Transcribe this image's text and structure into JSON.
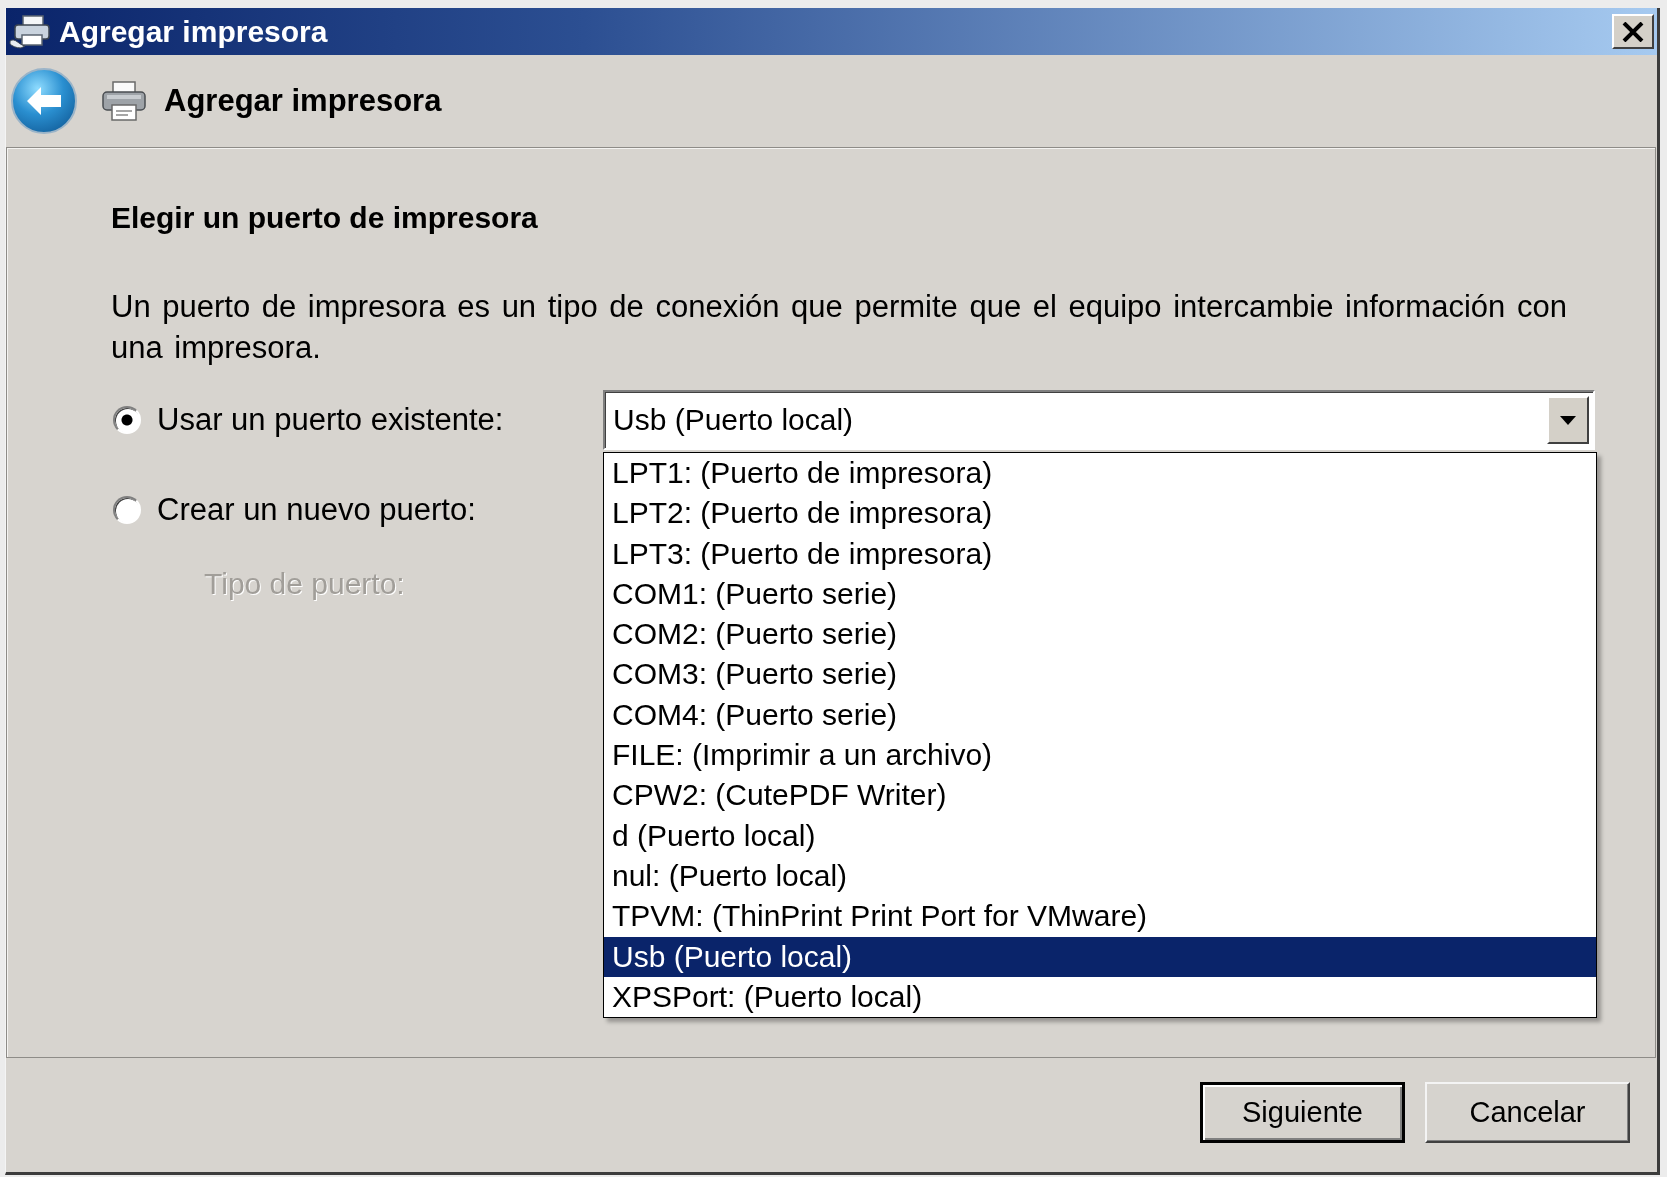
{
  "window": {
    "title": "Agregar impresora"
  },
  "header": {
    "title": "Agregar impresora"
  },
  "page": {
    "heading": "Elegir un puerto de impresora",
    "description": "Un puerto de impresora es un tipo de conexión que permite que el equipo intercambie información con una impresora.",
    "port_options": [
      {
        "label": "Usar un puerto existente:",
        "selected": true
      },
      {
        "label": "Crear un nuevo puerto:",
        "selected": false
      }
    ],
    "existing_port": {
      "value": "Usb (Puerto local)",
      "expanded": true,
      "options": [
        {
          "label": "LPT1: (Puerto de impresora)",
          "selected": false
        },
        {
          "label": "LPT2: (Puerto de impresora)",
          "selected": false
        },
        {
          "label": "LPT3: (Puerto de impresora)",
          "selected": false
        },
        {
          "label": "COM1: (Puerto serie)",
          "selected": false
        },
        {
          "label": "COM2: (Puerto serie)",
          "selected": false
        },
        {
          "label": "COM3: (Puerto serie)",
          "selected": false
        },
        {
          "label": "COM4: (Puerto serie)",
          "selected": false
        },
        {
          "label": "FILE: (Imprimir a un archivo)",
          "selected": false
        },
        {
          "label": "CPW2: (CutePDF Writer)",
          "selected": false
        },
        {
          "label": "d (Puerto local)",
          "selected": false
        },
        {
          "label": "nul: (Puerto local)",
          "selected": false
        },
        {
          "label": "TPVM: (ThinPrint Print Port for VMware)",
          "selected": false
        },
        {
          "label": "Usb (Puerto local)",
          "selected": true
        },
        {
          "label": "XPSPort: (Puerto local)",
          "selected": false
        }
      ]
    },
    "port_type": {
      "label": "Tipo de puerto:",
      "disabled": true
    }
  },
  "buttons": [
    {
      "label": "Siguiente",
      "default": true
    },
    {
      "label": "Cancelar",
      "default": false
    }
  ]
}
